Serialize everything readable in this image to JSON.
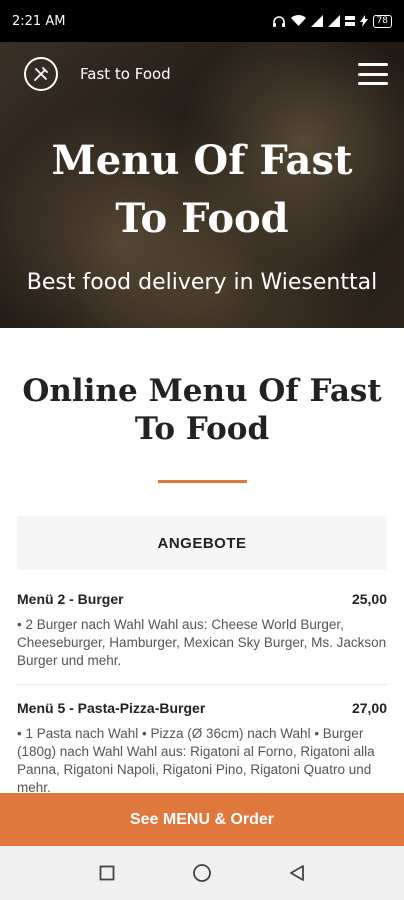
{
  "status_bar": {
    "time": "2:21 AM",
    "battery": "78",
    "icons": [
      "headphones-icon",
      "wifi-icon",
      "signal-icon",
      "signal-icon",
      "data-speed-icon",
      "charging-icon",
      "battery-icon"
    ]
  },
  "header": {
    "brand_name": "Fast to Food",
    "logo_icon": "fork-knife-icon",
    "menu_icon": "hamburger-menu-icon"
  },
  "hero": {
    "title": "Menu Of Fast To Food",
    "subtitle": "Best food delivery in Wiesenttal"
  },
  "main": {
    "section_title": "Online Menu Of Fast To Food",
    "accent_color": "#e0783e",
    "category": "ANGEBOTE",
    "items": [
      {
        "name": "Menü 2 - Burger",
        "price": "25,00",
        "description": "• 2 Burger nach Wahl Wahl aus: Cheese World Burger, Cheeseburger, Hamburger, Mexican Sky Burger, Ms. Jackson Burger und mehr."
      },
      {
        "name": "Menü 5 - Pasta-Pizza-Burger",
        "price": "27,00",
        "description": "• 1 Pasta nach Wahl • Pizza (Ø 36cm) nach Wahl • Burger (180g) nach Wahl Wahl aus: Rigatoni al Forno, Rigatoni alla Panna, Rigatoni Napoli, Rigatoni Pino, Rigatoni Quatro und mehr."
      }
    ]
  },
  "cta": {
    "label": "See MENU & Order"
  },
  "android_nav": {
    "buttons": [
      "recents-icon",
      "home-icon",
      "back-icon"
    ]
  }
}
